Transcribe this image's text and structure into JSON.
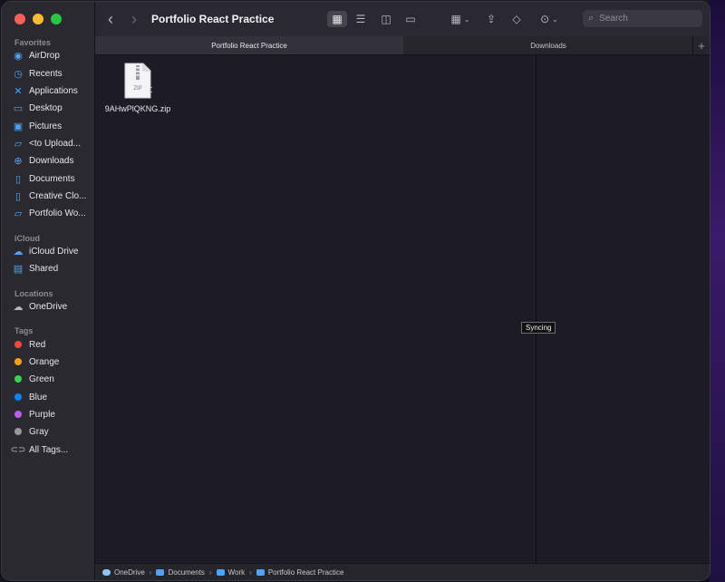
{
  "window": {
    "title": "Portfolio React Practice"
  },
  "sidebar": {
    "favorites_title": "Favorites",
    "favorites": [
      {
        "label": "AirDrop",
        "icon": "airdrop-icon"
      },
      {
        "label": "Recents",
        "icon": "clock-icon"
      },
      {
        "label": "Applications",
        "icon": "applications-icon"
      },
      {
        "label": "Desktop",
        "icon": "desktop-icon"
      },
      {
        "label": "Pictures",
        "icon": "pictures-icon"
      },
      {
        "label": "<to Upload...",
        "icon": "folder-icon"
      },
      {
        "label": "Downloads",
        "icon": "downloads-icon"
      },
      {
        "label": "Documents",
        "icon": "document-icon"
      },
      {
        "label": "Creative Clo...",
        "icon": "document-icon"
      },
      {
        "label": "Portfolio Wo...",
        "icon": "folder-icon"
      }
    ],
    "icloud_title": "iCloud",
    "icloud": [
      {
        "label": "iCloud Drive",
        "icon": "cloud-icon"
      },
      {
        "label": "Shared",
        "icon": "shared-folder-icon"
      }
    ],
    "locations_title": "Locations",
    "locations": [
      {
        "label": "OneDrive",
        "icon": "cloud-icon"
      }
    ],
    "tags_title": "Tags",
    "tags": [
      {
        "label": "Red",
        "color": "#ff453a"
      },
      {
        "label": "Orange",
        "color": "#ff9f0a"
      },
      {
        "label": "Green",
        "color": "#32d74b"
      },
      {
        "label": "Blue",
        "color": "#0a84ff"
      },
      {
        "label": "Purple",
        "color": "#bf5af2"
      },
      {
        "label": "Gray",
        "color": "#98989d"
      },
      {
        "label": "All Tags...",
        "color": ""
      }
    ]
  },
  "toolbar": {
    "search_placeholder": "Search"
  },
  "tabs": [
    {
      "label": "Portfolio React Practice",
      "active": true
    },
    {
      "label": "Downloads",
      "active": false
    }
  ],
  "files": [
    {
      "name": "9AHwPlQKNG.zip",
      "type_label": "ZIP"
    }
  ],
  "tooltip": "Syncing",
  "pathbar": [
    "OneDrive",
    "Documents",
    "Work",
    "Portfolio React Practice"
  ]
}
